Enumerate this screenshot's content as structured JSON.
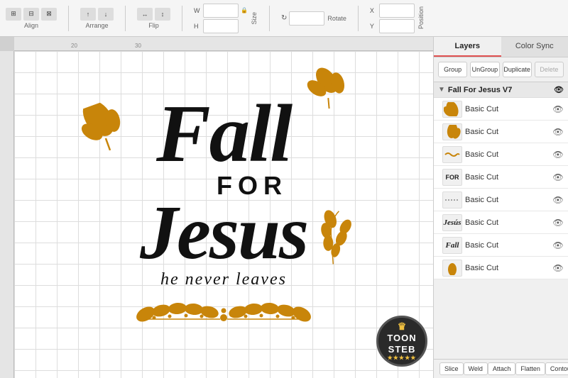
{
  "toolbar": {
    "align_label": "Align",
    "arrange_label": "Arrange",
    "flip_label": "Flip",
    "size_label": "Size",
    "rotate_label": "Rotate",
    "position_label": "Position",
    "w_label": "W",
    "h_label": "H",
    "x_label": "X",
    "y_label": "Y"
  },
  "panel": {
    "tab_layers": "Layers",
    "tab_color_sync": "Color Sync",
    "btn_group": "Group",
    "btn_ungroup": "UnGroup",
    "btn_duplicate": "Duplicate",
    "btn_delete": "Delete",
    "group_name": "Fall For Jesus V7",
    "layers": [
      {
        "id": 1,
        "name": "Basic Cut",
        "thumb_type": "leaf_gold",
        "visible": true
      },
      {
        "id": 2,
        "name": "Basic Cut",
        "thumb_type": "leaf_gold2",
        "visible": true
      },
      {
        "id": 3,
        "name": "Basic Cut",
        "thumb_type": "squiggle",
        "visible": true
      },
      {
        "id": 4,
        "name": "Basic Cut",
        "thumb_type": "for_text",
        "visible": true
      },
      {
        "id": 5,
        "name": "Basic Cut",
        "thumb_type": "dots_line",
        "visible": true
      },
      {
        "id": 6,
        "name": "Basic Cut",
        "thumb_type": "jesus_script",
        "visible": true
      },
      {
        "id": 7,
        "name": "Basic Cut",
        "thumb_type": "fall_script",
        "visible": true
      },
      {
        "id": 8,
        "name": "Basic Cut",
        "thumb_type": "small_leaf",
        "visible": true
      }
    ]
  },
  "bottom_buttons": [
    "Slice",
    "Weld",
    "Attach",
    "Flatten",
    "Contour"
  ],
  "design": {
    "title": "Fall For Jesus",
    "subtitle": "He Never Leaves",
    "main_text_fall": "Fall",
    "main_text_for": "FOR",
    "main_text_jesus": "Jesus",
    "tagline": "he never leaves"
  },
  "logo": {
    "line1": "TOON",
    "line2": "STEB"
  },
  "ruler": {
    "top_marks": [
      "20",
      "30"
    ],
    "left_marks": []
  }
}
